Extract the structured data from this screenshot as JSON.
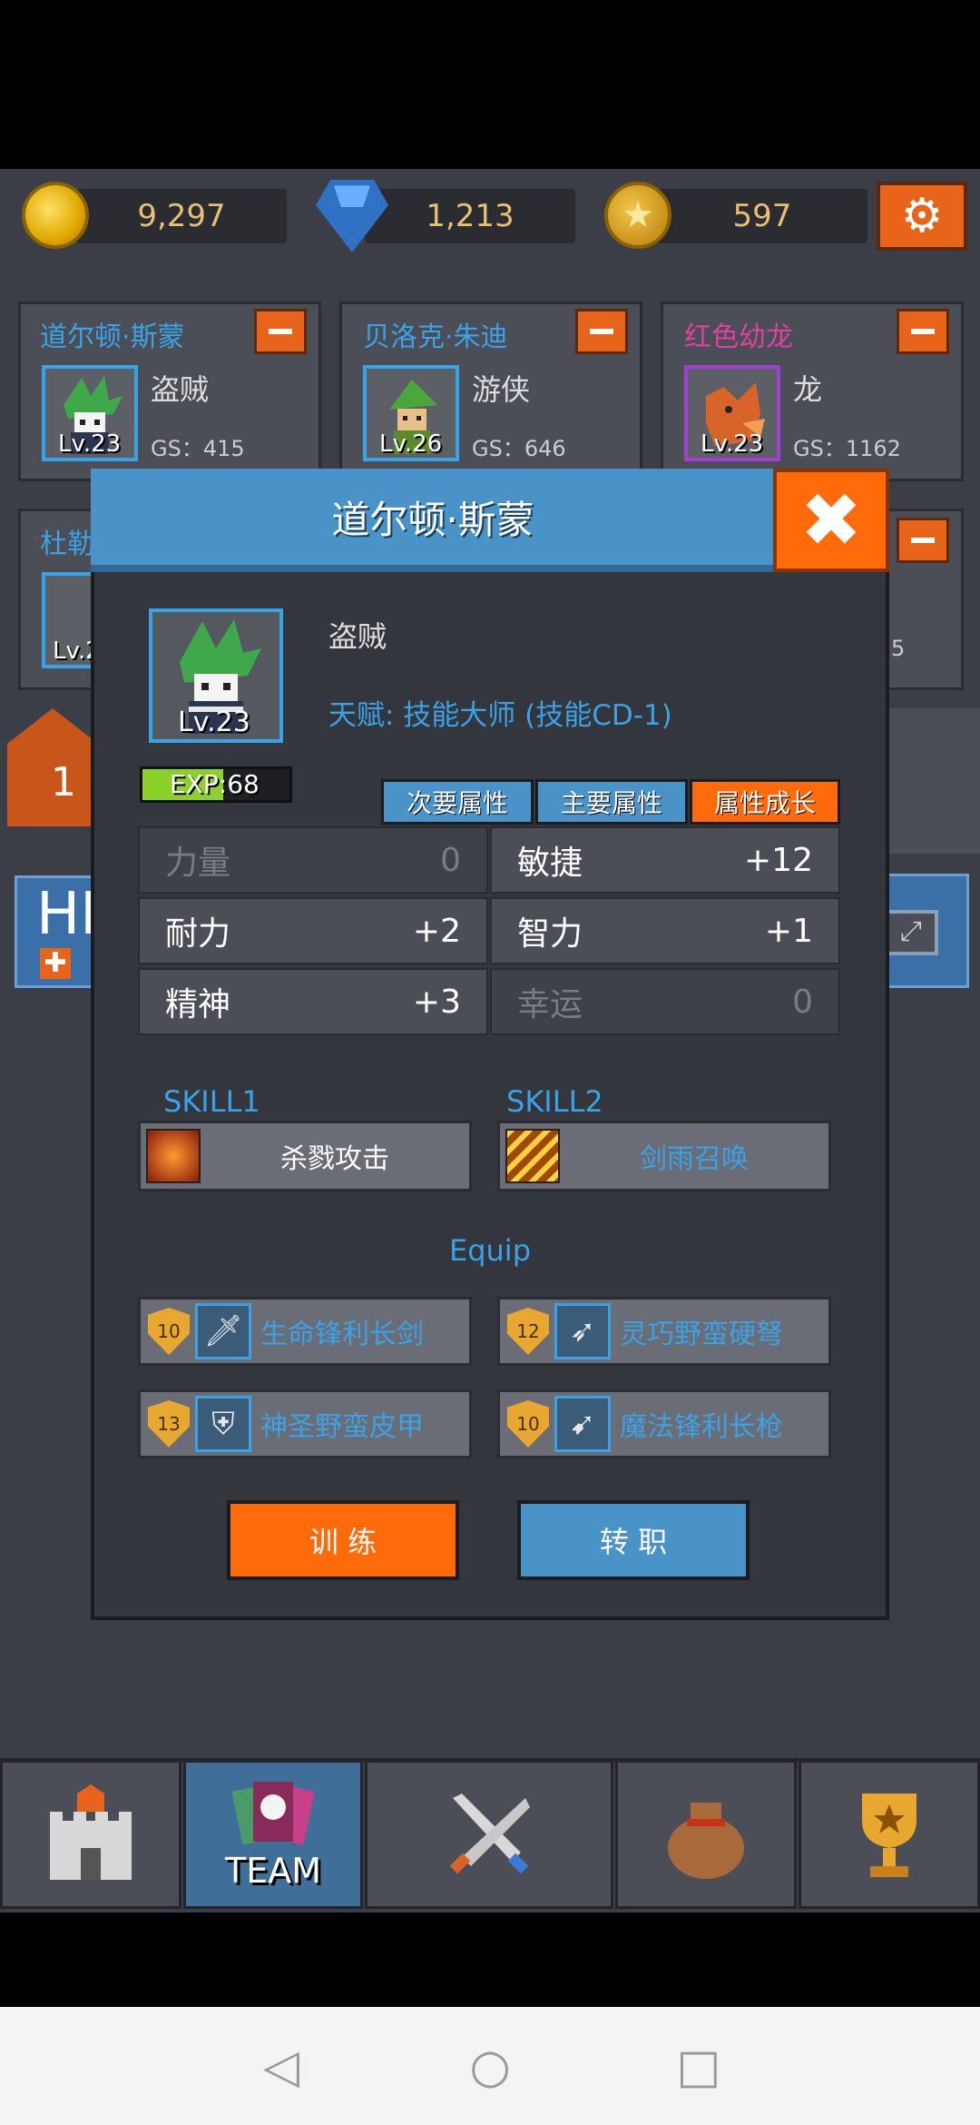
{
  "currency": {
    "gold": "9,297",
    "gems": "1,213",
    "stars": "597"
  },
  "team_cards": [
    {
      "name": "道尔顿·斯蒙",
      "class": "盗贼",
      "level": "Lv.23",
      "gs": "GS：415"
    },
    {
      "name": "贝洛克·朱迪",
      "class": "游侠",
      "level": "Lv.26",
      "gs": "GS：646"
    },
    {
      "name": "红色幼龙",
      "class": "龙",
      "level": "Lv.23",
      "gs": "GS：1162"
    }
  ],
  "partial": {
    "row2_name": "杜勒",
    "row2_level": "Lv.2",
    "side_number": "1",
    "hp_text": "HI",
    "right_num": "5"
  },
  "modal": {
    "title": "道尔顿·斯蒙",
    "close_glyph": "✖",
    "hero_level": "Lv.23",
    "hero_class": "盗贼",
    "talent": "天赋: 技能大师 (技能CD-1)",
    "exp_text": "EXP:68",
    "exp_fraction": 0.55,
    "tabs": [
      "次要属性",
      "主要属性",
      "属性成长"
    ],
    "stats": [
      {
        "name": "力量",
        "value": "0",
        "active": false
      },
      {
        "name": "敏捷",
        "value": "+12",
        "active": true
      },
      {
        "name": "耐力",
        "value": "+2",
        "active": true
      },
      {
        "name": "智力",
        "value": "+1",
        "active": true
      },
      {
        "name": "精神",
        "value": "+3",
        "active": true
      },
      {
        "name": "幸运",
        "value": "0",
        "active": false
      }
    ],
    "skill1_label": "SKILL1",
    "skill2_label": "SKILL2",
    "skill1_name": "杀戮攻击",
    "skill2_name": "剑雨召唤",
    "equip_label": "Equip",
    "equips": [
      {
        "level": "10",
        "name": "生命锋利长剑",
        "icon": "sword-icon",
        "glyph": "🗡"
      },
      {
        "level": "12",
        "name": "灵巧野蛮硬弩",
        "icon": "crossbow-icon",
        "glyph": "➶"
      },
      {
        "level": "13",
        "name": "神圣野蛮皮甲",
        "icon": "armor-icon",
        "glyph": "⛨"
      },
      {
        "level": "10",
        "name": "魔法锋利长枪",
        "icon": "spear-icon",
        "glyph": "➹"
      }
    ],
    "train_label": "训 练",
    "class_change_label": "转 职"
  },
  "nav": {
    "team_label": "TEAM",
    "icons": [
      "castle-icon",
      "team-icon",
      "crossed-swords-icon",
      "loot-bag-icon",
      "trophy-icon"
    ]
  },
  "colors": {
    "accent_blue": "#4a93c9",
    "accent_orange": "#ff6a0a",
    "text_blue": "#3aa3e8"
  }
}
